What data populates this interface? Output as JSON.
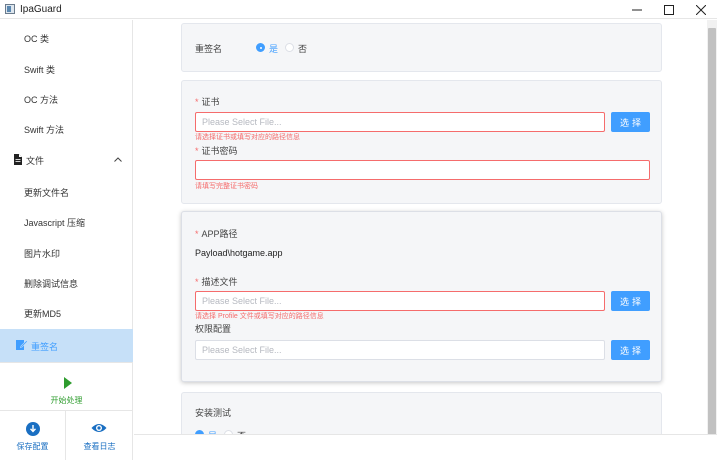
{
  "window": {
    "title": "IpaGuard"
  },
  "sidebar": {
    "items": [
      {
        "label": "OC 类"
      },
      {
        "label": "Swift 类"
      },
      {
        "label": "OC 方法"
      },
      {
        "label": "Swift 方法"
      }
    ],
    "group": {
      "label": "文件",
      "icon": "file-icon"
    },
    "subitems": [
      {
        "label": "更新文件名"
      },
      {
        "label": "Javascript 压缩"
      },
      {
        "label": "图片水印"
      },
      {
        "label": "删除调试信息"
      },
      {
        "label": "更新MD5"
      }
    ],
    "active": {
      "label": "重签名",
      "icon": "edit-icon"
    },
    "start": {
      "label": "开始处理"
    },
    "save": {
      "label": "保存配置"
    },
    "log": {
      "label": "查看日志"
    }
  },
  "main": {
    "resign": {
      "label": "重签名",
      "yes": "是",
      "no": "否"
    },
    "cert": {
      "label": "证书",
      "placeholder": "Please Select File...",
      "button": "选择",
      "error": "请选择证书或填写对应的路径信息"
    },
    "cert_password": {
      "label": "证书密码",
      "value": "",
      "error": "请填写完整证书密码"
    },
    "app": {
      "label": "APP路径",
      "value": "Payload\\hotgame.app"
    },
    "profile": {
      "label": "描述文件",
      "placeholder": "Please Select File...",
      "button": "选择",
      "error": "请选择 Profile 文件或填写对应的路径信息"
    },
    "entitlements": {
      "label": "权限配置",
      "placeholder": "Please Select File...",
      "button": "选择"
    },
    "install_test": {
      "label": "安装测试",
      "yes": "是",
      "no": "否"
    }
  },
  "colors": {
    "accent": "#409eff",
    "error": "#f56c6c",
    "active_bg": "#c6e0f8",
    "start": "#2e9c2e"
  }
}
